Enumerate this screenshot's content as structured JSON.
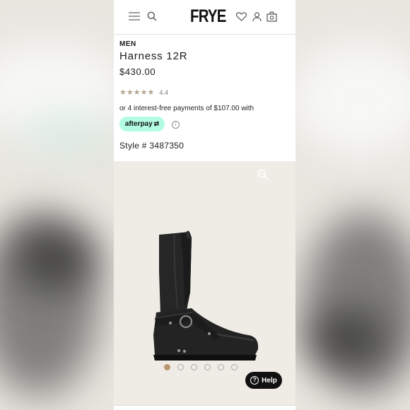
{
  "header": {
    "logo": "FRYE",
    "icons": [
      "menu-icon",
      "search-icon",
      "heart-icon",
      "account-icon",
      "bag-icon"
    ]
  },
  "product": {
    "category": "MEN",
    "name": "Harness 12R",
    "price": "$430.00",
    "rating_value": "4.4",
    "rating_stars": 4.4,
    "installment_text": "or 4 interest-free payments of $107.00 with",
    "afterpay_label": "afterpay",
    "style": "Style # 3487350"
  },
  "gallery": {
    "image_count": 6,
    "active_index": 0
  },
  "help": {
    "label": "Help"
  },
  "colors": {
    "star": "#b4a68d",
    "afterpay_bg": "#b2fce4",
    "active_dot": "#b9976e",
    "gallery_bg": "#efece6"
  }
}
